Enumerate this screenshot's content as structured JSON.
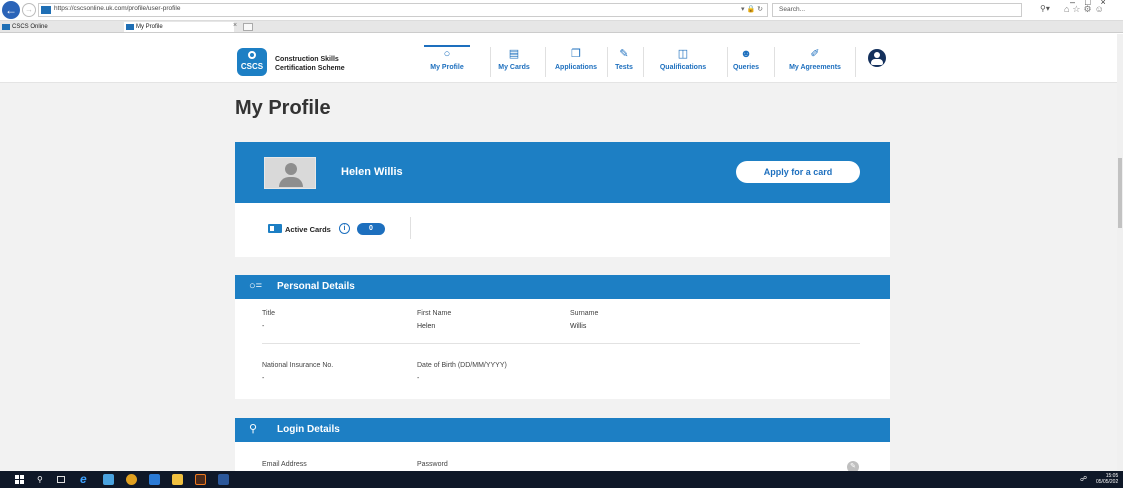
{
  "browser": {
    "url": "https://cscsonline.uk.com/profile/user-profile",
    "search_placeholder": "Search...",
    "url_icons": "▾ 🔒 ↻",
    "tabs": [
      {
        "label": "CSCS Online"
      },
      {
        "label": "My Profile"
      }
    ]
  },
  "header": {
    "logo_text": "CSCS",
    "brand_line1": "Construction Skills",
    "brand_line2": "Certification Scheme",
    "nav": [
      {
        "label": "My Profile",
        "icon": "person-icon",
        "active": true
      },
      {
        "label": "My Cards",
        "icon": "card-icon"
      },
      {
        "label": "Applications",
        "icon": "applications-icon"
      },
      {
        "label": "Tests",
        "icon": "tests-icon"
      },
      {
        "label": "Qualifications",
        "icon": "qualifications-icon"
      },
      {
        "label": "Queries",
        "icon": "queries-icon"
      },
      {
        "label": "My Agreements",
        "icon": "agreements-icon"
      }
    ]
  },
  "page": {
    "title": "My Profile"
  },
  "profile": {
    "name": "Helen Willis",
    "apply_label": "Apply for a card",
    "active_cards_label": "Active Cards",
    "active_cards_count": "0"
  },
  "personal": {
    "heading": "Personal Details",
    "title_label": "Title",
    "title_value": "-",
    "first_name_label": "First Name",
    "first_name_value": "Helen",
    "surname_label": "Surname",
    "surname_value": "Willis",
    "ni_label": "National Insurance No.",
    "ni_value": "-",
    "dob_label": "Date of Birth (DD/MM/YYYY)",
    "dob_value": "-"
  },
  "login": {
    "heading": "Login Details",
    "email_label": "Email Address",
    "password_label": "Password"
  },
  "taskbar": {
    "time": "15:05",
    "date": "05/05/202"
  },
  "colors": {
    "primary": "#1d7fc4",
    "nav_text": "#1d6fbe",
    "page_bg": "#f2f2f2",
    "taskbar": "#0f1828"
  }
}
